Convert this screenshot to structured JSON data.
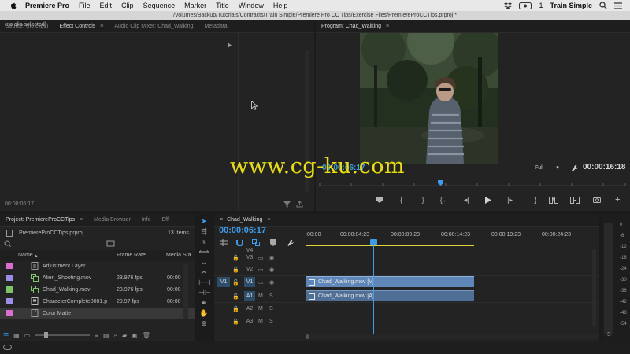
{
  "menubar": {
    "items": [
      "Premiere Pro",
      "File",
      "Edit",
      "Clip",
      "Sequence",
      "Marker",
      "Title",
      "Window",
      "Help"
    ],
    "status": [
      "1"
    ],
    "user": "Train Simple"
  },
  "titlebar": {
    "path": "/Volumes/Backup/Tutorials/Contracts/Train Simple/Premiere Pro CC Tips/Exercise Files/PremiereProCCTips.prproj *"
  },
  "source_panel": {
    "tabs": [
      "Source: (no clips)",
      "Effect Controls",
      "Audio Clip Mixer: Chad_Walking",
      "Metadata"
    ],
    "no_clip": "(no clip selected)",
    "timecode": "00:00:06:17"
  },
  "program_panel": {
    "tab": "Program: Chad_Walking",
    "timecode_current": "00:00:06:17",
    "fit": "Full",
    "timecode_duration": "00:00:16:18"
  },
  "project_panel": {
    "tabs": [
      "Project: PremiereProCCTips",
      "Media Browser",
      "Info",
      "Eff"
    ],
    "file": "PremiereProCCTips.prproj",
    "item_count": "13 Items",
    "columns": {
      "name": "Name",
      "frame_rate": "Frame Rate",
      "media_start": "Media Sta"
    },
    "items": [
      {
        "name": "Adjustment Layer",
        "frame_rate": "",
        "media_start": "",
        "color": "#d86fce",
        "icon": "adjustment-layer-icon"
      },
      {
        "name": "Alien_Shooting.mov",
        "frame_rate": "23.976 fps",
        "media_start": "00:00",
        "color": "#9b8ee8",
        "icon": "sequence-icon"
      },
      {
        "name": "Chad_Walking.mov",
        "frame_rate": "23.976 fps",
        "media_start": "00:00",
        "color": "#7ec46a",
        "icon": "sequence-icon"
      },
      {
        "name": "CharacterComplete0001.p",
        "frame_rate": "29.97 fps",
        "media_start": "00:00",
        "color": "#9b8ee8",
        "icon": "clip-icon"
      },
      {
        "name": "Color Matte",
        "frame_rate": "",
        "media_start": "",
        "color": "#d86fce",
        "icon": "color-matte-icon"
      }
    ]
  },
  "timeline": {
    "tab": "Chad_Walking",
    "timecode": "00:00:06:17",
    "ruler": [
      ":00:00",
      "00:00:04:23",
      "00:00:09:23",
      "00:00:14:23",
      "00:00:19:23",
      "00:00:24:23"
    ],
    "source_video": "V1",
    "tracks": [
      {
        "name": "V4",
        "t1": "",
        "t2": ""
      },
      {
        "name": "V3",
        "t1": "",
        "t2": ""
      },
      {
        "name": "V2",
        "t1": "",
        "t2": ""
      },
      {
        "name": "V1",
        "t1": "",
        "t2": ""
      },
      {
        "name": "A1",
        "t1": "M",
        "t2": "S"
      },
      {
        "name": "A2",
        "t1": "M",
        "t2": "S"
      },
      {
        "name": "A3",
        "t1": "M",
        "t2": "S"
      }
    ],
    "video_clip": "Chad_Walking.mov [V]",
    "audio_clip": "Chad_Walking.mov [A]"
  },
  "meter": {
    "db_labels": [
      "0",
      "-6",
      "-12",
      "-18",
      "-24",
      "-30",
      "-36",
      "-42",
      "-48",
      "-54"
    ],
    "solo": "S"
  },
  "watermark": "www.cg-ku.com",
  "colors": {
    "accent": "#3d9be9",
    "video_clip": "#5f86b9",
    "audio_clip": "#4f6f96",
    "in_out_bar": "#e2d53a",
    "watermark": "#e9e000"
  }
}
